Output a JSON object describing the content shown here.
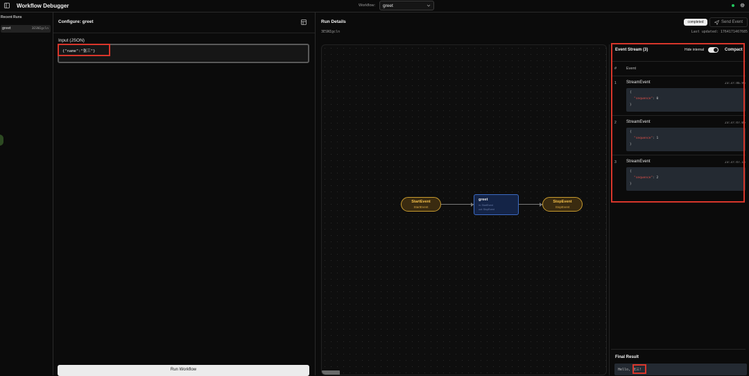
{
  "header": {
    "app_title": "Workflow Debugger",
    "workflow_label": "Workflow:",
    "workflow_selected": "greet"
  },
  "sidebar": {
    "heading": "Recent Runs",
    "runs": [
      {
        "name": "greet",
        "id": "3ESNIgcln"
      }
    ]
  },
  "config": {
    "title": "Configure: greet",
    "input_label": "Input (JSON)",
    "input_value": "{\"name\":\"张三\"}",
    "run_button": "Run Workflow"
  },
  "details": {
    "title": "Run Details",
    "run_id": "3ESNIgcln",
    "status": "completed",
    "send_event": "Send Event",
    "last_updated": "Last updated: 1764171467685"
  },
  "graph": {
    "start_node": {
      "title": "StartEvent",
      "subtitle": "StartEvent"
    },
    "step_node": {
      "title": "greet",
      "in": "in: StartEvent",
      "out": "out: StopEvent"
    },
    "stop_node": {
      "title": "StopEvent",
      "subtitle": "StopEvent"
    }
  },
  "event_stream": {
    "title": "Event Stream (3)",
    "hide_internal_label": "Hide internal",
    "hide_internal_on": true,
    "compact_label": "Compact",
    "col_num": "#",
    "col_event": "Event",
    "events": [
      {
        "num": "1",
        "name": "StreamEvent",
        "time": "23:37:46.953",
        "open": "{",
        "key": "\"sequence\"",
        "value": "0",
        "close": "}"
      },
      {
        "num": "2",
        "name": "StreamEvent",
        "time": "23:37:47.054",
        "open": "{",
        "key": "\"sequence\"",
        "value": "1",
        "close": "}"
      },
      {
        "num": "3",
        "name": "StreamEvent",
        "time": "23:37:47.155",
        "open": "{",
        "key": "\"sequence\"",
        "value": "2",
        "close": "}"
      }
    ]
  },
  "final_result": {
    "title": "Final Result",
    "prefix": "Hello, ",
    "name": "张三!"
  },
  "colors": {
    "accent_red": "#d9362b",
    "event_node": "#c89b2e",
    "step_node": "#3c6bc4",
    "status_green": "#22c55e"
  }
}
